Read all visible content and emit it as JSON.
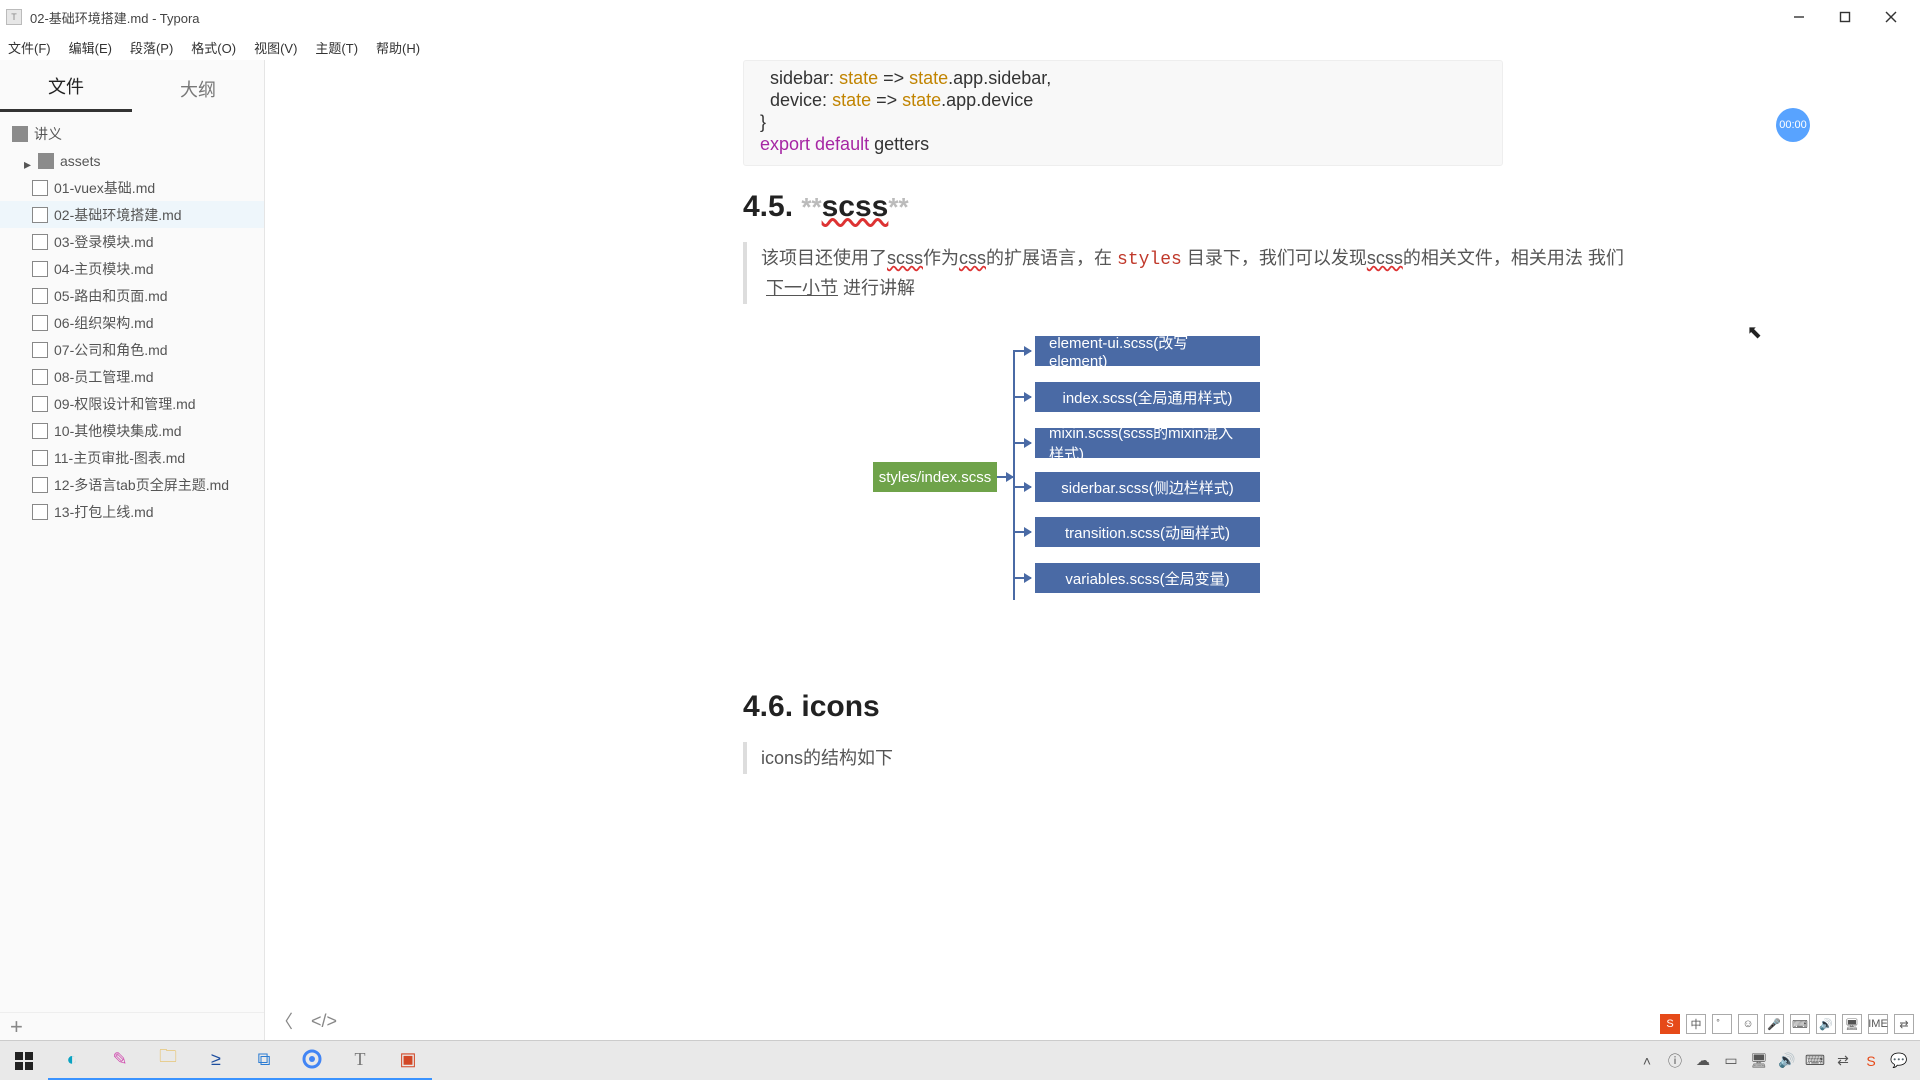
{
  "window": {
    "title": "02-基础环境搭建.md - Typora"
  },
  "menu": {
    "items": [
      "文件(F)",
      "编辑(E)",
      "段落(P)",
      "格式(O)",
      "视图(V)",
      "主题(T)",
      "帮助(H)"
    ]
  },
  "sidebar": {
    "tabs": {
      "files": "文件",
      "outline": "大纲"
    },
    "root": "讲义",
    "folder": "assets",
    "files": [
      "01-vuex基础.md",
      "02-基础环境搭建.md",
      "03-登录模块.md",
      "04-主页模块.md",
      "05-路由和页面.md",
      "06-组织架构.md",
      "07-公司和角色.md",
      "08-员工管理.md",
      "09-权限设计和管理.md",
      "10-其他模块集成.md",
      "11-主页审批-图表.md",
      "12-多语言tab页全屏主题.md",
      "13-打包上线.md"
    ],
    "selected_index": 1
  },
  "code": {
    "l1a": "sidebar: ",
    "l1b": "state",
    "l1c": " => ",
    "l1d": "state",
    "l1e": ".app.sidebar,",
    "l2a": "device: ",
    "l2b": "state",
    "l2c": " => ",
    "l2d": "state",
    "l2e": ".app.device",
    "l3": "}",
    "l4a": "export",
    "l4b": " default",
    "l4c": " getters"
  },
  "section45": {
    "num": "4.5. ",
    "stars": "**",
    "title": "scss",
    "p1a": "该项目还使用了",
    "p1_scss": "scss",
    "p1b": "作为",
    "p1_css": "css",
    "p1c": "的扩展语言，在 ",
    "p1_styles": "styles",
    "p1d": " 目录下，我们可以发现",
    "p1_scss2": "scss",
    "p1e": "的相关文件，相关用法 我们",
    "p2_link": "下一小节",
    "p2": " 进行讲解"
  },
  "diagram": {
    "root": "styles/index.scss",
    "leaves": [
      "element-ui.scss(改写element)",
      "index.scss(全局通用样式)",
      "mixin.scss(scss的mixin混入样式)",
      "siderbar.scss(侧边栏样式)",
      "transition.scss(动画样式)",
      "variables.scss(全局变量)"
    ]
  },
  "section46": {
    "num": "4.6. ",
    "title": "icons",
    "quote": "icons的结构如下"
  },
  "badge": "00:00",
  "taskbar": {
    "apps": [
      "start",
      "cloud",
      "clip",
      "explorer",
      "powershell",
      "vscode",
      "chrome",
      "typora",
      "powerpoint"
    ],
    "active": [
      1,
      2,
      3,
      4,
      5,
      6,
      7,
      8
    ]
  },
  "tray": {
    "items": [
      "S",
      "中",
      "゜",
      "☺",
      "🎤",
      "⌨",
      "🔊",
      "🖥",
      "IME",
      "⇄",
      "S",
      "🗨"
    ]
  }
}
